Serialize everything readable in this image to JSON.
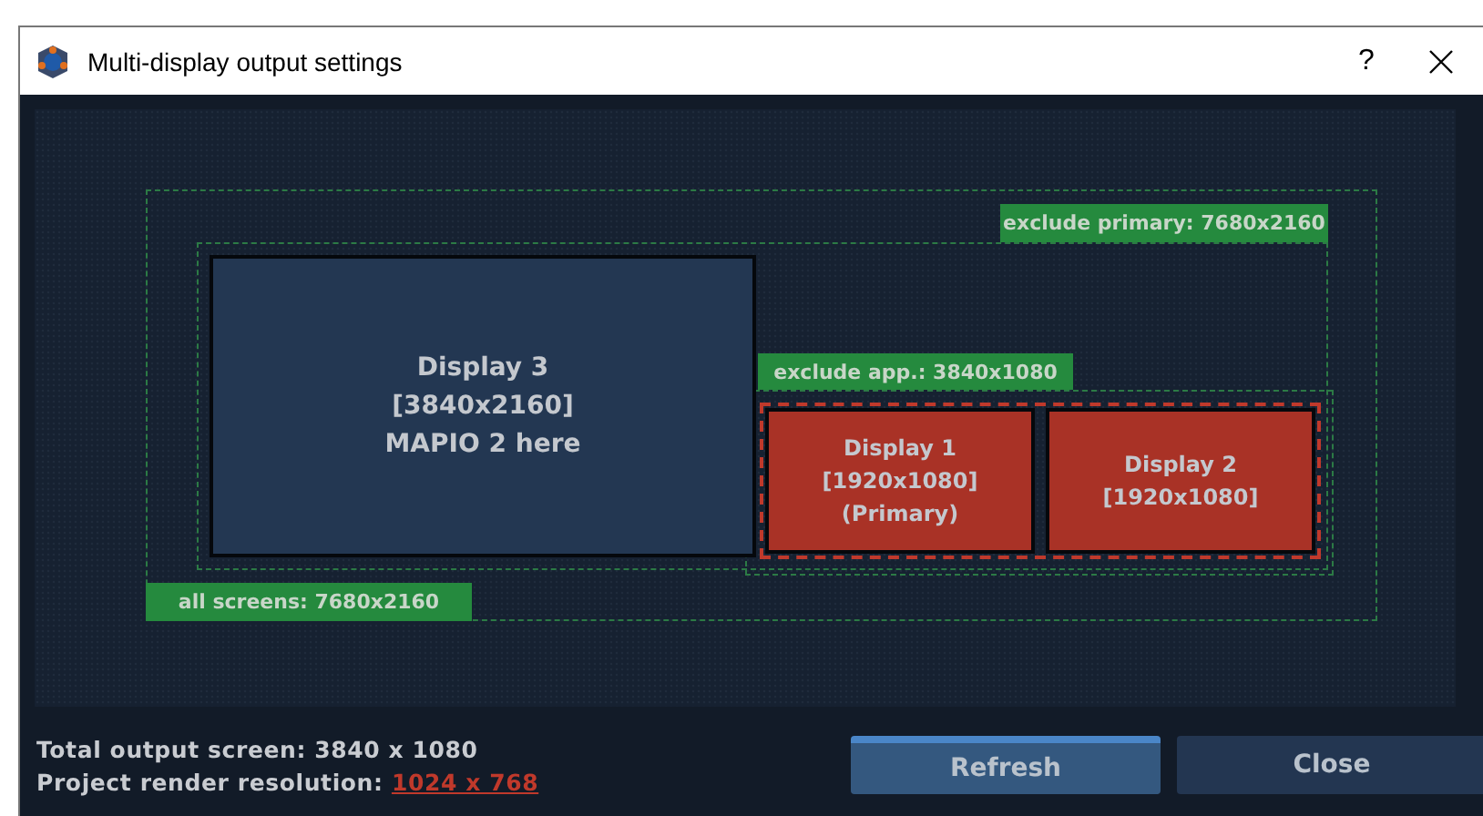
{
  "window": {
    "title": "Multi-display output settings",
    "help": "?"
  },
  "regions": [
    {
      "kind": "all",
      "label": "all screens: 7680x2160"
    },
    {
      "kind": "exclude-primary",
      "label": "exclude primary: 7680x2160"
    },
    {
      "kind": "exclude-app",
      "label": "exclude app.: 3840x1080"
    }
  ],
  "displays": [
    {
      "lines": [
        "Display 3",
        "[3840x2160]",
        "MAPIO 2 here"
      ],
      "excluded": false
    },
    {
      "lines": [
        "Display 1",
        "[1920x1080]",
        "(Primary)"
      ],
      "excluded": true
    },
    {
      "lines": [
        "Display 2",
        "[1920x1080]"
      ],
      "excluded": true
    }
  ],
  "footer": {
    "total_label": "Total output screen: 3840 x 1080",
    "render_label": "Project render resolution:",
    "render_value": "1024 x 768"
  },
  "buttons": [
    {
      "label": "Refresh",
      "kind": "primary"
    },
    {
      "label": "Close",
      "kind": "secondary"
    }
  ]
}
